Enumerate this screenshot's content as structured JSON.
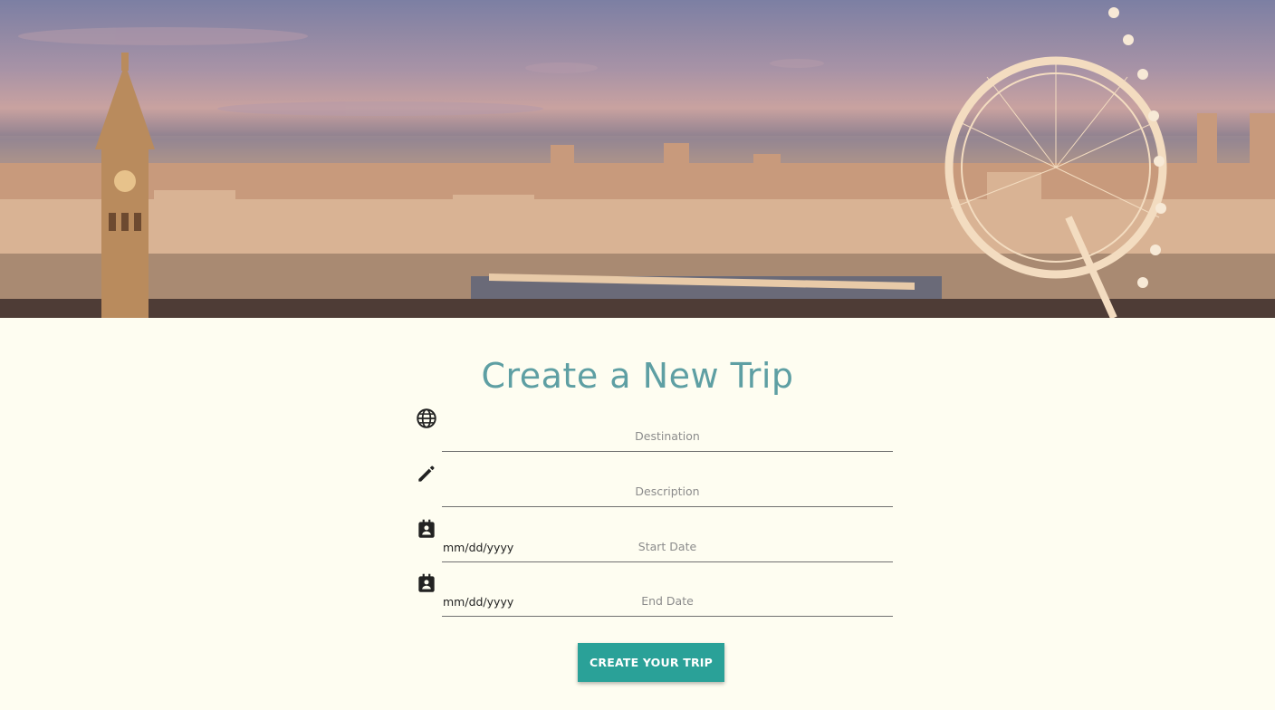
{
  "hero": {
    "image": "london-skyline-photo"
  },
  "form": {
    "title": "Create a New Trip",
    "fields": [
      {
        "icon": "globe-icon",
        "label": "Destination",
        "value": ""
      },
      {
        "icon": "pencil-icon",
        "label": "Description",
        "value": ""
      },
      {
        "icon": "calendar-icon",
        "label": "Start Date",
        "value": "mm/dd/yyyy"
      },
      {
        "icon": "calendar-icon",
        "label": "End Date",
        "value": "mm/dd/yyyy"
      }
    ],
    "submit_label": "CREATE YOUR TRIP"
  },
  "colors": {
    "accent": "#2aa198",
    "title": "#5e9fa3",
    "background": "#fefdf1"
  }
}
